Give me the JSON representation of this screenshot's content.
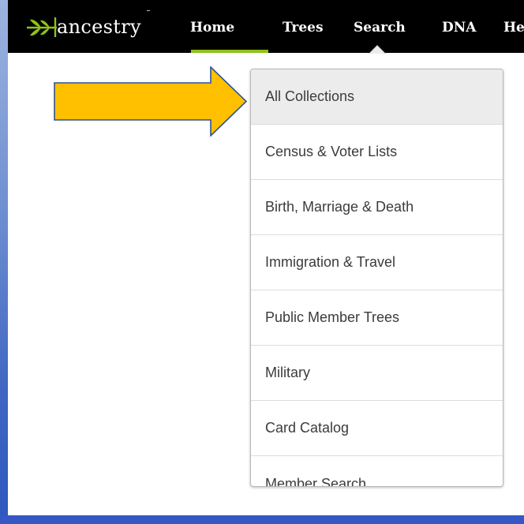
{
  "header": {
    "logo_text": "ancestry",
    "logo_icon": "leaf-sprig-icon",
    "nav": [
      {
        "label": "Home"
      },
      {
        "label": "Trees"
      },
      {
        "label": "Search"
      },
      {
        "label": "DNA"
      },
      {
        "label": "Hea"
      }
    ]
  },
  "search_menu": {
    "items": [
      {
        "label": "All Collections"
      },
      {
        "label": "Census & Voter Lists"
      },
      {
        "label": "Birth, Marriage & Death"
      },
      {
        "label": "Immigration & Travel"
      },
      {
        "label": "Public Member Trees"
      },
      {
        "label": "Military"
      },
      {
        "label": "Card Catalog"
      },
      {
        "label": "Member Search"
      }
    ]
  },
  "annotation": {
    "arrow_icon": "right-arrow-icon",
    "arrow_color": "#ffc000",
    "arrow_outline": "#2f528f"
  },
  "colors": {
    "nav_background": "#000000",
    "active_underline": "#8fc21e",
    "slide_frame": "#3558c5"
  }
}
